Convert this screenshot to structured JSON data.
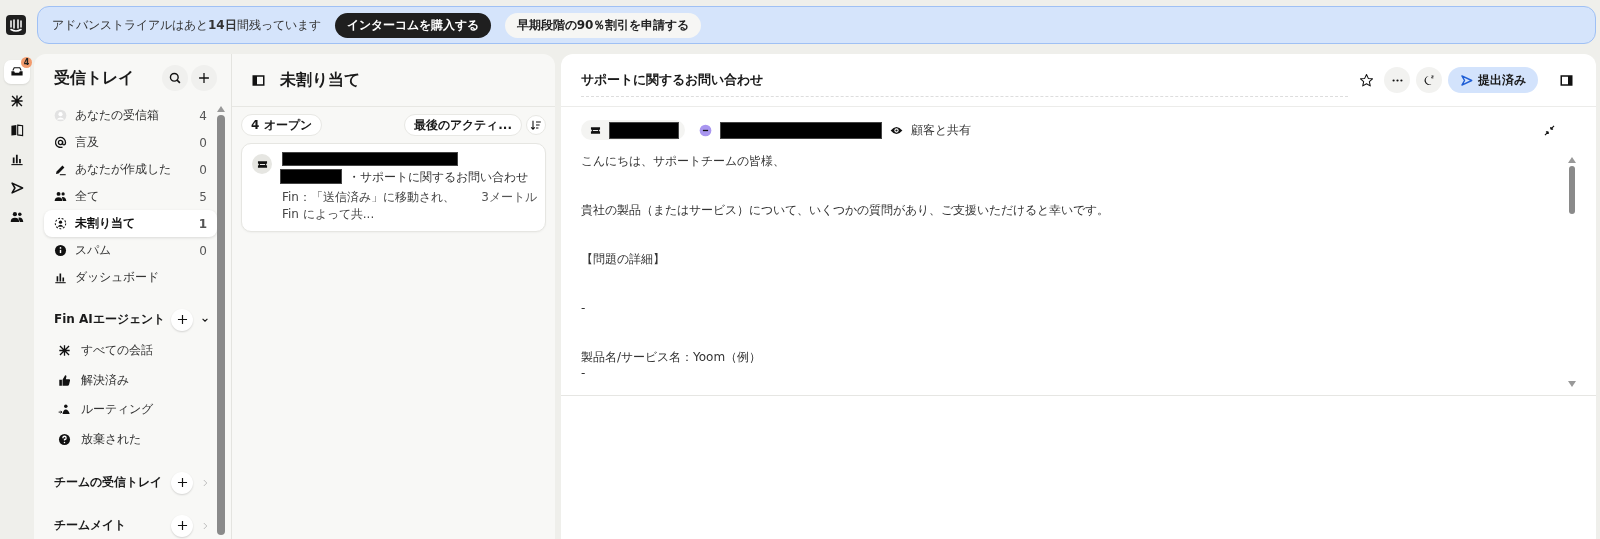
{
  "banner": {
    "message": "アドバンストライアルはあと**14日**間残っています",
    "buttons": [
      {
        "label": "インターコムを購入する",
        "kind": "primary"
      },
      {
        "label": "早期段階の90％割引を申請する",
        "kind": "secondary"
      }
    ]
  },
  "rail": {
    "items": [
      {
        "kind": "inbox",
        "badge": "4",
        "selected": true
      },
      {
        "kind": "fin",
        "selected": false
      },
      {
        "kind": "book",
        "selected": false
      },
      {
        "kind": "chart",
        "selected": false
      },
      {
        "kind": "send",
        "selected": false
      },
      {
        "kind": "people",
        "selected": false
      }
    ]
  },
  "sidebar": {
    "title": "受信トレイ",
    "items": [
      {
        "kind": "avatar",
        "label": "あなたの受信箱",
        "count": "4",
        "selected": false
      },
      {
        "kind": "at",
        "label": "言及",
        "count": "0",
        "selected": false
      },
      {
        "kind": "pen",
        "label": "あなたが作成した",
        "count": "0",
        "selected": false
      },
      {
        "kind": "people",
        "label": "全て",
        "count": "5",
        "selected": false
      },
      {
        "kind": "unassigned",
        "label": "未割り当て",
        "count": "1",
        "selected": true
      },
      {
        "kind": "info",
        "label": "スパム",
        "count": "0",
        "selected": false
      },
      {
        "kind": "chart",
        "label": "ダッシュボード",
        "selected": false
      }
    ],
    "sections": [
      {
        "title": "Fin AIエージェント",
        "expanded": true,
        "items": [
          {
            "kind": "fin",
            "label": "すべての会話",
            "selected": false
          },
          {
            "kind": "thumb",
            "label": "解決済み",
            "selected": false
          },
          {
            "kind": "routing",
            "label": "ルーティング",
            "selected": false
          },
          {
            "kind": "question",
            "label": "放棄された",
            "selected": false
          }
        ]
      },
      {
        "title": "チームの受信トレイ",
        "expanded": false
      },
      {
        "title": "チームメイト",
        "expanded": false
      }
    ]
  },
  "list": {
    "title": "未割り当て",
    "open_count": "4 オープン",
    "sort": "最後のアクティ...",
    "conversations": [
      {
        "subject": "・サポートに関するお問い合わせ",
        "preview": "Fin：「送信済み」に移動され、Fin によって共...",
        "time": "3メートル",
        "selected": false
      }
    ]
  },
  "conversation": {
    "title": "サポートに関するお問い合わせ",
    "status": "提出済み",
    "visibility": "顧客と共有",
    "paragraphs": [
      [
        "こんにちは、サポートチームの皆様、"
      ],
      [
        "貴社の製品（またはサービス）について、いくつかの質問があり、ご支援いただけると幸いです。"
      ],
      [
        "【問題の詳細】"
      ],
      [
        "-"
      ],
      [
        "製品名/サービス名：Yoom（例）",
        "-"
      ]
    ]
  }
}
